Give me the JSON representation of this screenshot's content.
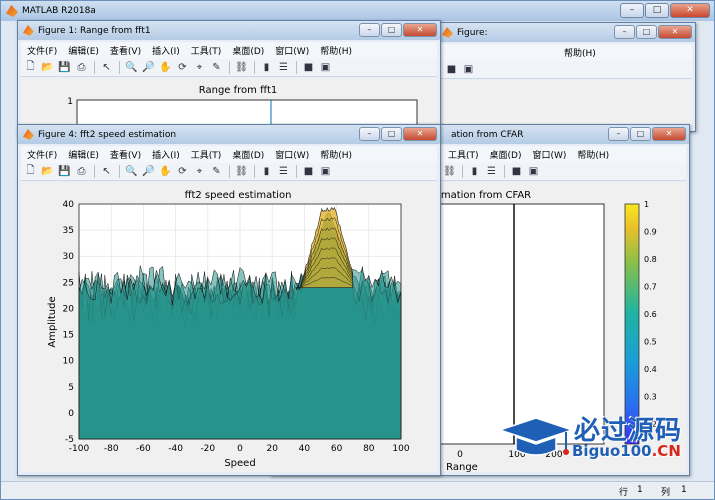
{
  "app": {
    "title": "MATLAB R2018a"
  },
  "window_buttons": {
    "minimize": "–",
    "maximize": "□",
    "close": "✕"
  },
  "menu": [
    "文件(F)",
    "编辑(E)",
    "查看(V)",
    "插入(I)",
    "工具(T)",
    "桌面(D)",
    "窗口(W)",
    "帮助(H)"
  ],
  "menu_partial": {
    "help": "帮助(H)"
  },
  "figure1": {
    "title": "Figure 1: Range from fft1",
    "axes_title": "Range from fft1",
    "ytick_top": "1"
  },
  "figure_bg": {
    "title_partial": "Figure:",
    "menu_partial": [
      "工具(T)",
      "桌面(D)",
      "窗口(W)",
      "帮助(H)"
    ]
  },
  "figure_cfar": {
    "title_partial": "ation from CFAR",
    "axes_title_partial": "mation from CFAR",
    "xlabel_partial": "Range",
    "xtick_partial": [
      "0",
      "100",
      "200"
    ],
    "menu_partial": [
      "工具(T)",
      "桌面(D)",
      "窗口(W)",
      "帮助(H)"
    ],
    "colorbar_ticks": [
      "1",
      "0.9",
      "0.8",
      "0.7",
      "0.6",
      "0.5",
      "0.4",
      "0.3",
      "0.2"
    ]
  },
  "figure4": {
    "title": "Figure 4: fft2 speed estimation"
  },
  "status": {
    "row_label": "行",
    "row_value": "1",
    "col_label": "列",
    "col_value": "1"
  },
  "watermark": {
    "cn": "必过源码",
    "en_prefix": "Biguo100",
    "en_suffix": ".CN"
  },
  "icons": {
    "toolbar": [
      "new-file-icon",
      "open-folder-icon",
      "save-icon",
      "print-icon",
      "pointer-icon",
      "zoom-in-icon",
      "zoom-out-icon",
      "pan-icon",
      "rotate-icon",
      "data-cursor-icon",
      "brush-icon",
      "link-icon",
      "colorbar-icon",
      "legend-icon",
      "hide-plot-tools-icon",
      "show-plot-tools-icon"
    ]
  },
  "colors": {
    "surface_low": "#2fa38f",
    "surface_high": "#e0b020",
    "colorbar_top": "#f7e81f",
    "colorbar_bottom": "#3c2ef5"
  },
  "chart_data": {
    "type": "surface",
    "title": "fft2 speed estimation",
    "xlabel": "Speed",
    "ylabel": "Amplitude",
    "xlim": [
      -100,
      100
    ],
    "ylim": [
      -5,
      40
    ],
    "xticks": [
      -100,
      -80,
      -60,
      -40,
      -20,
      0,
      20,
      40,
      60,
      80,
      100
    ],
    "yticks": [
      -5,
      0,
      5,
      10,
      15,
      20,
      25,
      30,
      35,
      40
    ],
    "grid": true,
    "noise_floor_top": 24,
    "noise_floor_bottom": 10,
    "peak": {
      "x": 55,
      "y": 39,
      "x_start": 35,
      "x_end": 70
    },
    "colormap": "parula"
  }
}
